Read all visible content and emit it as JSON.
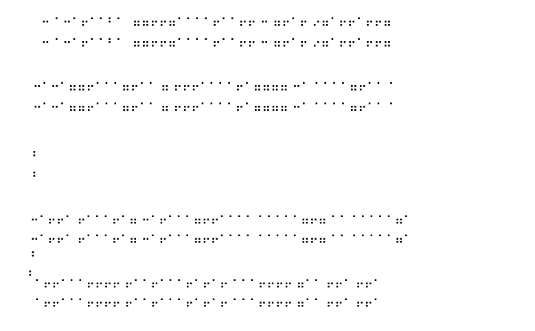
{
  "lines": [
    "⠒ ⠁⠒⠁⠖⠁⠁⠃⠁  ⠶⠶⠖⠖⠶⠁⠁⠁⠁⠖⠁⠁⠖⠖ ⠒ ⠶⠖⠁⠖ ⠔⠶⠁⠖⠖⠁⠖⠖⠶",
    "⠒ ⠁⠒⠁⠖⠁⠁⠃⠁  ⠶⠶⠖⠖⠶⠁⠁⠁⠁⠖⠁⠁⠖⠖ ⠒ ⠶⠖⠁⠖ ⠔⠶⠁⠖⠖⠁⠖⠖⠶",
    "⠒⠁⠒⠁⠶⠶⠖⠁⠁⠁⠶⠖⠁⠁ ⠶ ⠖⠖⠖⠁⠁⠁⠁⠖⠁⠶⠶⠶⠶ ⠒⠁ ⠁⠁⠁⠁⠶⠖⠁⠁ ⠁",
    "⠒⠁⠒⠁⠶⠶⠖⠁⠁⠁⠶⠖⠁⠁ ⠶ ⠖⠖⠖⠁⠁⠁⠁⠖⠁⠶⠶⠶⠶ ⠒⠁ ⠁⠁⠁⠁⠶⠖⠁⠁ ⠁",
    "⠆",
    "⠆",
    "⠒⠁⠖⠖⠁ ⠖⠁⠁⠁⠖⠁⠶ ⠒⠁⠖⠁⠁⠁⠶⠖⠖⠁⠁⠁⠁ ⠁⠁⠁⠁⠁⠶⠖⠶ ⠁⠁ ⠁⠁⠁⠁⠁⠶⠁",
    "⠒⠁⠖⠖⠁ ⠖⠁⠁⠁⠖⠁⠶ ⠒⠁⠖⠁⠁⠁⠶⠖⠖⠁⠁⠁⠁ ⠁⠁⠁⠁⠁⠶⠖⠶ ⠁⠁ ⠁⠁⠁⠁⠁⠶⠁",
    "⠆",
    "⠆",
    "⠁⠖⠖⠁⠁⠁⠖⠖⠖⠖ ⠖⠁⠁⠖⠁⠁⠁⠖⠁⠖⠁⠖ ⠁⠁⠁⠖⠖⠖⠖ ⠶⠁⠁ ⠖⠖⠁ ⠖⠖⠁",
    "⠁⠖⠖⠁⠁⠁⠖⠖⠖⠖ ⠖⠁⠁⠖⠁⠁⠁⠖⠁⠖⠁⠖ ⠁⠁⠁⠖⠖⠖⠖ ⠶⠁⠁ ⠖⠖⠁ ⠖⠖⠁"
  ]
}
